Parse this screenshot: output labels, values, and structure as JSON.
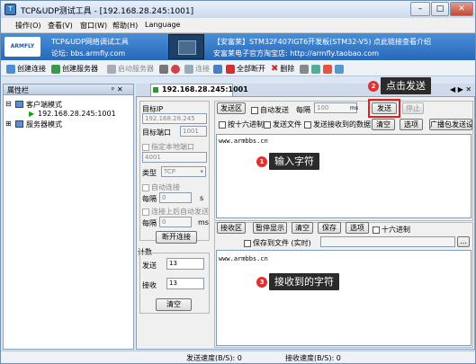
{
  "title": "TCP&UDP测试工具 - [192.168.28.245:1001]",
  "menu": [
    "操作(O)",
    "查看(V)",
    "窗口(W)",
    "帮助(H)",
    "Language"
  ],
  "banner": {
    "logo": "ARMFLY",
    "tool_name": "TCP&UDP网络调试工具",
    "forum": "论坛: bbs.armfly.com",
    "ad": "【安富莱】STM32F407IGT6开发板(STM32-V5) 点此链接查看介绍",
    "shop": "安富莱电子官方淘宝店: http://armfly.taobao.com"
  },
  "toolbar": {
    "create_conn": "创建连接",
    "create_server": "创建服务器",
    "start_server": "启动服务器",
    "connect": "连接",
    "disconnect_all": "全部断开",
    "delete": "删除"
  },
  "left_panel": {
    "title": "属性栏",
    "pin": "ᵖ ✕",
    "client_mode": "客户端模式",
    "client_item": "192.168.28.245:1001",
    "server_mode": "服务器模式"
  },
  "tab": {
    "label": "192.168.28.245:1001",
    "nav": "◀ ▶ ✕"
  },
  "settings": {
    "target_ip_label": "目标IP",
    "target_ip": "192.168.28.245",
    "target_port_label": "目标端口",
    "target_port": "1001",
    "local_port_chk": "指定本地端口",
    "local_port": "4001",
    "type_label": "类型",
    "type_value": "TCP",
    "auto_conn": "自动连接",
    "every1": "每隔",
    "every1_val": "0",
    "every1_unit": "s",
    "reconnect": "连接上后自动发送",
    "every2": "每隔",
    "every2_val": "0",
    "every2_unit": "ms",
    "disconnect_btn": "断开连接",
    "count_label": "计数",
    "send_label": "发送",
    "send_count": "13",
    "recv_label": "接收",
    "recv_count": "13",
    "clear_btn": "清空"
  },
  "send_area": {
    "label": "发送区",
    "auto_send": "自动发送",
    "every": "每隔",
    "interval": "100",
    "unit": "ms",
    "send_btn": "发送",
    "stop_btn": "停止",
    "hex_send": "按十六进制",
    "send_file": "发送文件",
    "send_recv": "发送接收到的数据",
    "clear_btn": "清空",
    "options_btn": "选项",
    "broadcast_btn": "广播包发送设",
    "content": "www.armbbs.cn"
  },
  "recv_area": {
    "label": "接收区",
    "pause_btn": "暂停显示",
    "clear_btn": "清空",
    "save_btn": "保存",
    "options_btn": "选项",
    "hex_chk": "十六进制",
    "save_file_chk": "保存到文件 (实时)",
    "dots": "...",
    "content": "www.armbbs.cn"
  },
  "annotations": {
    "a1_num": "1",
    "a1": "输入字符",
    "a2_num": "2",
    "a2": "点击发送",
    "a3_num": "3",
    "a3": "接收到的字符"
  },
  "status": {
    "send_speed": "发送速度(B/S): 0",
    "recv_speed": "接收速度(B/S): 0"
  }
}
